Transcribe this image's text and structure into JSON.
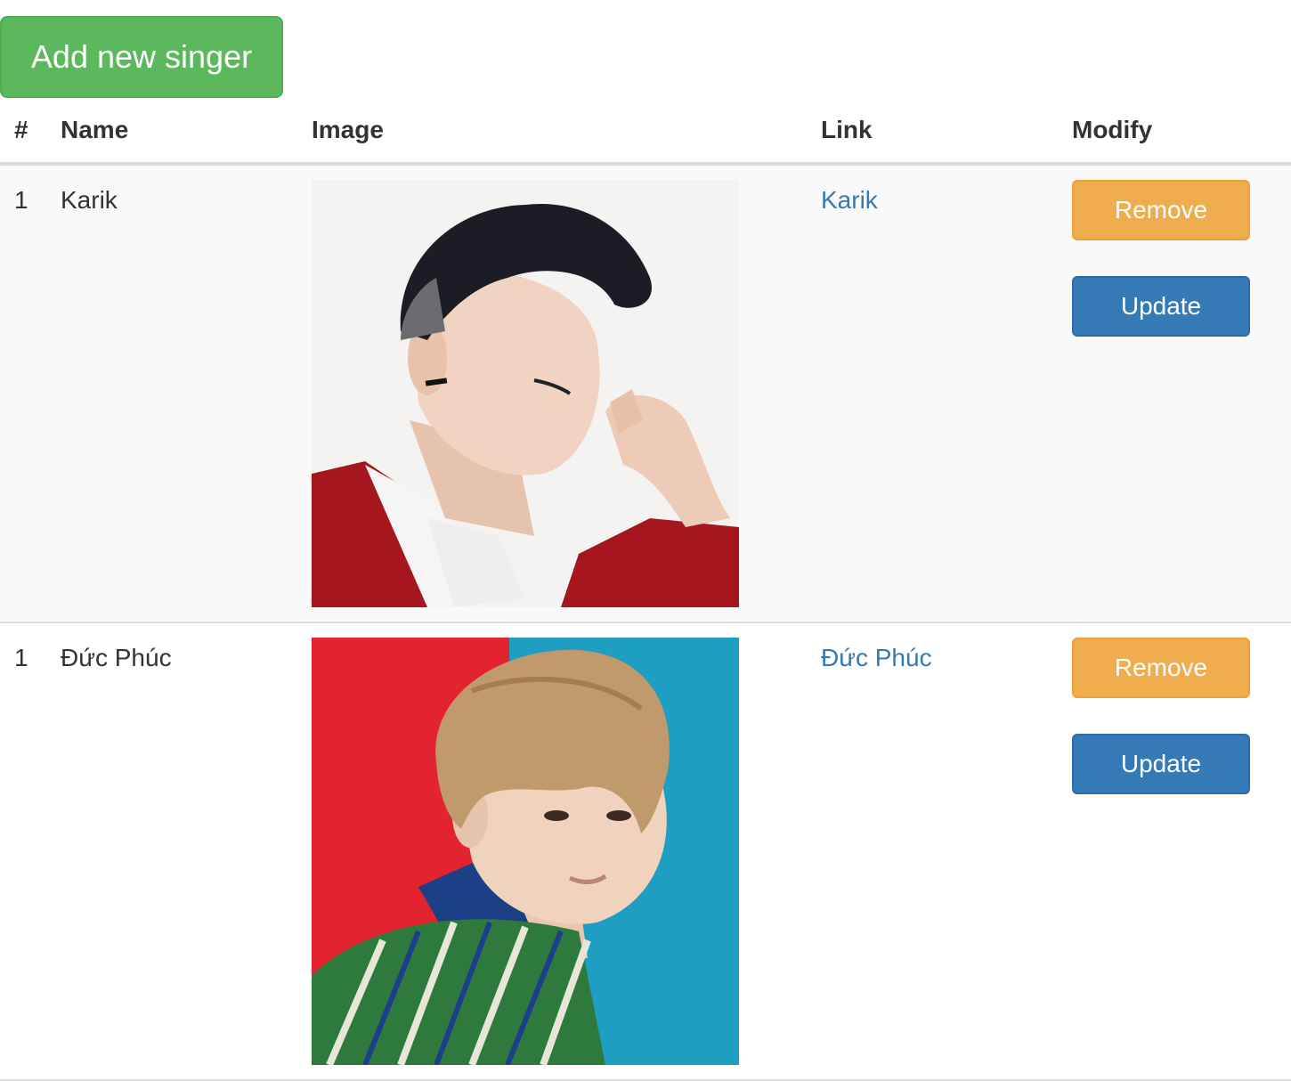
{
  "toolbar": {
    "add_label": "Add new singer"
  },
  "table": {
    "headers": {
      "num": "#",
      "name": "Name",
      "image": "Image",
      "link": "Link",
      "modify": "Modify"
    },
    "rows": [
      {
        "num": "1",
        "name": "Karik",
        "image": {
          "alt": "Karik"
        },
        "link": "Karik",
        "remove_label": "Remove",
        "update_label": "Update"
      },
      {
        "num": "1",
        "name": "Đức Phúc",
        "image": {
          "alt": "Đức Phúc"
        },
        "link": "Đức Phúc",
        "remove_label": "Remove",
        "update_label": "Update"
      }
    ]
  },
  "colors": {
    "success": "#5cb85c",
    "warning": "#f0ad4e",
    "primary": "#337ab7",
    "link": "#337ab7"
  }
}
